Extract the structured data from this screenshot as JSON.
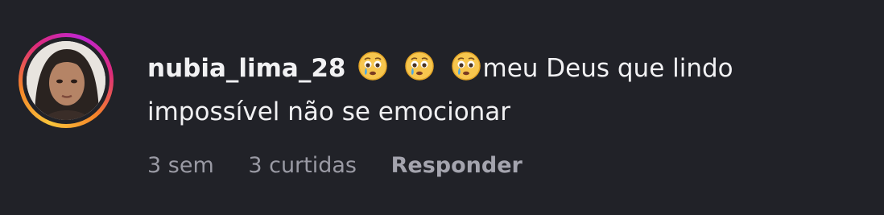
{
  "comment": {
    "username": "nubia_lima_28",
    "emoji": [
      "crying-face-emoji",
      "crying-face-emoji",
      "crying-face-emoji"
    ],
    "text": "meu Deus que lindo impossível não se emocionar",
    "time_ago": "3 sem",
    "likes": "3 curtidas",
    "reply_label": "Responder"
  },
  "colors": {
    "background": "#212228",
    "text": "#f1f1f3",
    "meta_text": "#9a9aa4"
  }
}
